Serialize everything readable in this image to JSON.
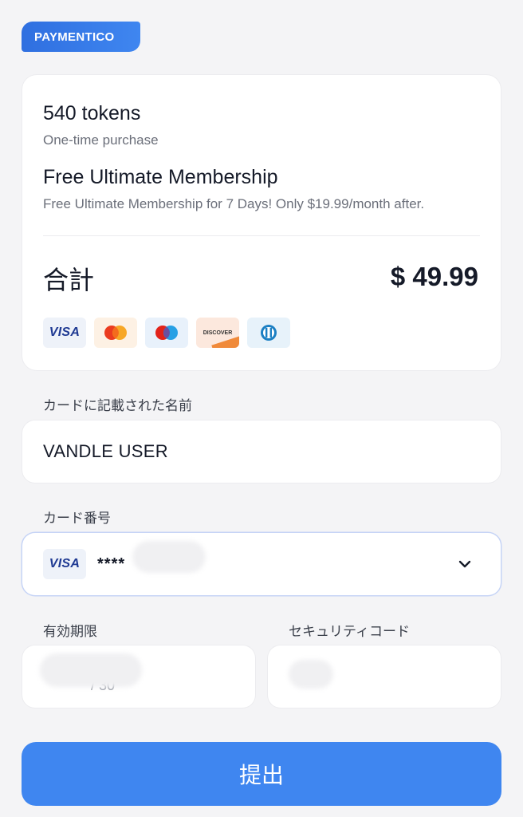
{
  "brand": {
    "label": "PAYMENTICO"
  },
  "summary": {
    "product_title": "540 tokens",
    "product_subtitle": "One-time purchase",
    "membership_title": "Free Ultimate Membership",
    "membership_subtitle": "Free Ultimate Membership for 7 Days! Only $19.99/month after.",
    "total_label": "合計",
    "total_value": "$ 49.99",
    "card_logos": [
      {
        "name": "visa",
        "label": "VISA"
      },
      {
        "name": "mastercard"
      },
      {
        "name": "maestro"
      },
      {
        "name": "discover",
        "label": "DISCOVER"
      },
      {
        "name": "diners-club"
      }
    ]
  },
  "form": {
    "name_label": "カードに記載された名前",
    "name_value": "VANDLE USER",
    "card_label": "カード番号",
    "card_brand": "VISA",
    "card_value": "****",
    "expiry_label": "有効期限",
    "expiry_value": "/ 30",
    "cvc_label": "セキュリティコード",
    "submit_label": "提出"
  },
  "colors": {
    "accent": "#3f86f0",
    "background": "#f4f4f6",
    "card_bg": "#ffffff",
    "visa_blue": "#1f3a93"
  }
}
